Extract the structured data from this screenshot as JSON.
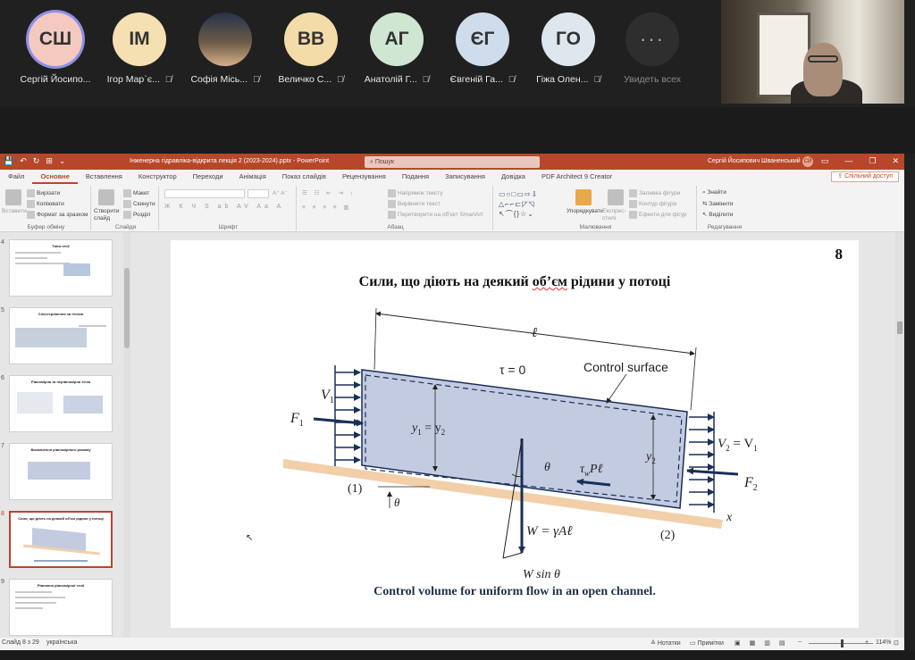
{
  "meeting": {
    "participants": [
      {
        "initials": "СШ",
        "name": "Сергій Йосипо...",
        "color": "#f4c9c0",
        "active": true,
        "muted": false
      },
      {
        "initials": "ІМ",
        "name": "Ігор Мар`є...",
        "color": "#f4e0b0",
        "active": false,
        "muted": true
      },
      {
        "initials": "",
        "name": "Софія Місь...",
        "color": "#5a4a3a",
        "active": false,
        "muted": true,
        "photo": true
      },
      {
        "initials": "ВВ",
        "name": "Величко С...",
        "color": "#f4dca8",
        "active": false,
        "muted": true
      },
      {
        "initials": "АГ",
        "name": "Анатолій Г...",
        "color": "#cfe6d2",
        "active": false,
        "muted": true
      },
      {
        "initials": "ЄГ",
        "name": "Євгеній Га...",
        "color": "#cfdcec",
        "active": false,
        "muted": true
      },
      {
        "initials": "ГО",
        "name": "Гіжа Олен...",
        "color": "#dfe7ee",
        "active": false,
        "muted": true
      }
    ],
    "more": {
      "glyph": "···",
      "label": "Увидеть всех"
    }
  },
  "ppt": {
    "file_title": "Інженерна гідравліка-відкрита лекція 2 (2023-2024).pptx  -  PowerPoint",
    "search_placeholder": "Пошук",
    "user_name": "Сергій Йосипович Шваненський",
    "user_badge": "СЙ",
    "tabs": [
      "Файл",
      "Основне",
      "Вставлення",
      "Конструктор",
      "Переходи",
      "Анімація",
      "Показ слайдів",
      "Рецензування",
      "Подання",
      "Записування",
      "Довідка",
      "PDF Architect 9 Creator"
    ],
    "active_tab": "Основне",
    "share_label": "Спільний доступ",
    "ribbon": {
      "clipboard": {
        "paste": "Вставити",
        "cut": "Вирізати",
        "copy": "Копіювати",
        "format": "Формат за зразком",
        "label": "Буфер обміну"
      },
      "slides": {
        "new_slide": "Створити слайд",
        "layout": "Макет",
        "reset": "Скинути",
        "section": "Розділ",
        "label": "Слайди"
      },
      "font": {
        "label": "Шрифт"
      },
      "paragraph": {
        "direction": "Напрямок тексту",
        "align": "Вирівняти текст",
        "smartart": "Перетворити на об'єкт SmartArt",
        "label": "Абзац"
      },
      "drawing": {
        "arrange": "Упорядкувати",
        "styles": "Експрес-стилі",
        "fill": "Заливка фігури",
        "outline": "Контур фігури",
        "effects": "Ефекти для фігур",
        "label": "Малювання"
      },
      "editing": {
        "find": "Знайти",
        "replace": "Замінити",
        "select": "Виділити",
        "label": "Редагування"
      }
    },
    "thumbnails": [
      {
        "num": "4",
        "title": "Типи течії"
      },
      {
        "num": "5",
        "title": "Спостереження за течією"
      },
      {
        "num": "6",
        "title": "Рівномірна та нерівномірна течія"
      },
      {
        "num": "7",
        "title": "Визначення рівномірного режиму"
      },
      {
        "num": "8",
        "title": "Сили, що діють на деякий об'єм рідини у потоці",
        "selected": true
      },
      {
        "num": "9",
        "title": "Рівняння рівномірної течії"
      }
    ],
    "status": {
      "slide_info": "Слайд 8 з 29",
      "language": "українська",
      "notes": "Нотатки",
      "comments": "Примітки",
      "zoom": "114%"
    }
  },
  "slide": {
    "number": "8",
    "title_before": "Сили, що діють на деякий ",
    "title_squiggle": "об’єм",
    "title_after": " рідини у потоці",
    "caption": "Control volume for uniform flow in an open channel.",
    "labels": {
      "length": "ℓ",
      "tau": "τ = 0",
      "control_surface": "Control surface",
      "v1": "V",
      "v1_sub": "1",
      "f1": "F",
      "f1_sub": "1",
      "y1y2": "y",
      "y1y2_mid": " = y",
      "y_sub1": "1",
      "y_sub2": "2",
      "y2": "y",
      "y2_sub": "2",
      "v2": "V",
      "v2_mid": " = V",
      "v2_sub2": "2",
      "v2_sub1": "1",
      "f2": "F",
      "f2_sub": "2",
      "theta": "θ",
      "shear": "τ",
      "shear_sub": "w",
      "shear_rest": "Pℓ",
      "weight": "W = γAℓ",
      "weight_sin": "W sin θ",
      "section1": "(1)",
      "section2": "(2)",
      "x_axis": "x"
    }
  },
  "colors": {
    "ppt_accent": "#b7472a",
    "water": "#c3cbe1",
    "channel_bed": "#f2cfa9",
    "arrow": "#1a2f57"
  }
}
